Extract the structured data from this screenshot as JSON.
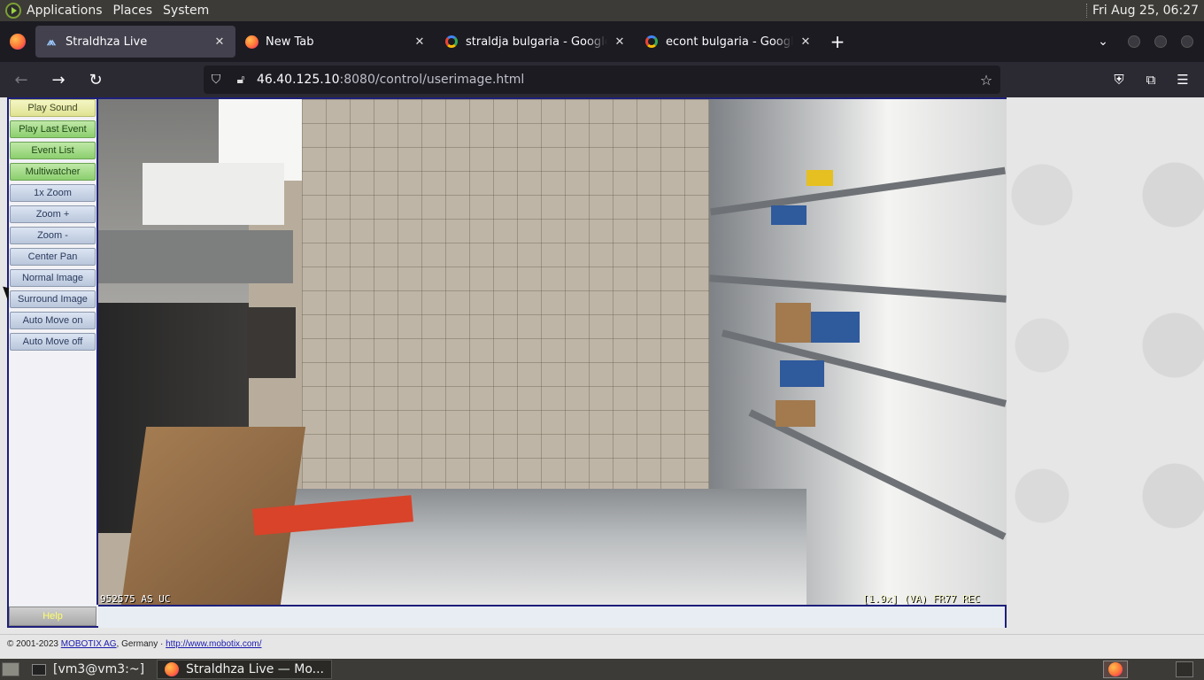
{
  "top_panel": {
    "menus": [
      "Applications",
      "Places",
      "System"
    ],
    "clock": "Fri Aug 25, 06:27"
  },
  "tabs": [
    {
      "title": "Straldhza Live",
      "favicon": "mobotix-icon",
      "active": true
    },
    {
      "title": "New Tab",
      "favicon": "firefox-icon",
      "active": false
    },
    {
      "title": "straldja bulgaria - Google Se",
      "favicon": "google-icon",
      "active": false
    },
    {
      "title": "econt bulgaria - Google Sea",
      "favicon": "google-icon",
      "active": false
    }
  ],
  "navbar": {
    "url_host": "46.40.125.10",
    "url_rest": ":8080/control/userimage.html"
  },
  "sidebar": {
    "buttons": [
      {
        "label": "Play Sound",
        "style": "yellow"
      },
      {
        "label": "Play Last Event",
        "style": "green"
      },
      {
        "label": "Event List",
        "style": "green"
      },
      {
        "label": "Multiwatcher",
        "style": "green"
      },
      {
        "label": "1x Zoom",
        "style": "blue"
      },
      {
        "label": "Zoom +",
        "style": "blue"
      },
      {
        "label": "Zoom -",
        "style": "blue"
      },
      {
        "label": "Center Pan",
        "style": "blue"
      },
      {
        "label": "Normal Image",
        "style": "blue"
      },
      {
        "label": "Surround Image",
        "style": "blue"
      },
      {
        "label": "Auto Move on",
        "style": "blue"
      },
      {
        "label": "Auto Move off",
        "style": "blue"
      }
    ],
    "help_label": "Help"
  },
  "camera": {
    "overlay_left": "952575 AS UC",
    "overlay_right": "[1.9x] (VA) FR77 REC"
  },
  "footer": {
    "copyright": "© 2001-2023",
    "company_link": "MOBOTIX AG",
    "country": ", Germany · ",
    "website_link": "http://www.mobotix.com/"
  },
  "taskbar": {
    "items": [
      {
        "label": "[vm3@vm3:~]",
        "icon": "terminal-icon",
        "active": false
      },
      {
        "label": "Straldhza Live — Mo...",
        "icon": "firefox-icon",
        "active": true
      }
    ]
  },
  "colors": {
    "frame_border": "#1d1f7a",
    "button_green": "#8ccf6e",
    "button_yellow": "#e0e392",
    "button_blue": "#b9c6db"
  }
}
